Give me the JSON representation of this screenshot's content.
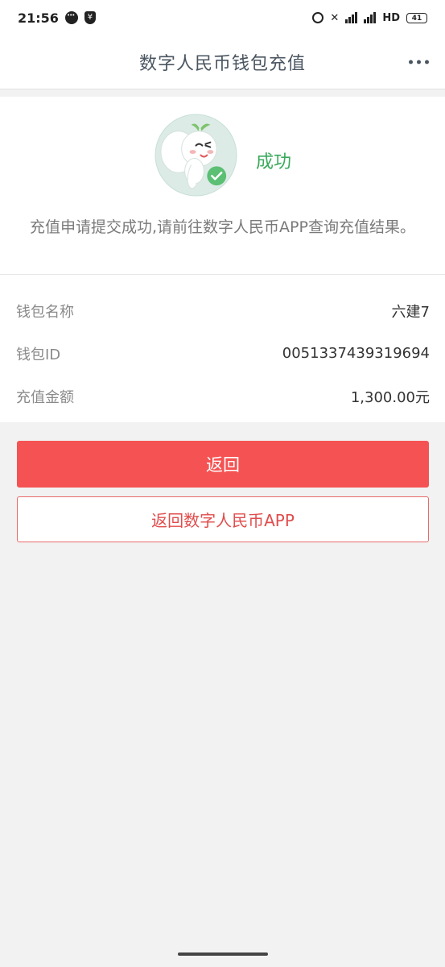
{
  "status_bar": {
    "time": "21:56",
    "hd_label": "HD",
    "battery": "41"
  },
  "header": {
    "title": "数字人民币钱包充值"
  },
  "result": {
    "status": "成功",
    "message": "充值申请提交成功,请前往数字人民币APP查询充值结果。"
  },
  "details": {
    "rows": [
      {
        "label": "钱包名称",
        "value": "六建7"
      },
      {
        "label": "钱包ID",
        "value": "0051337439319694"
      },
      {
        "label": "充值金额",
        "value": "1,300.00元"
      }
    ]
  },
  "actions": {
    "back_label": "返回",
    "back_to_app_label": "返回数字人民币APP"
  },
  "colors": {
    "primary": "#f55353",
    "success": "#3aaa5c",
    "background": "#f2f2f2"
  }
}
